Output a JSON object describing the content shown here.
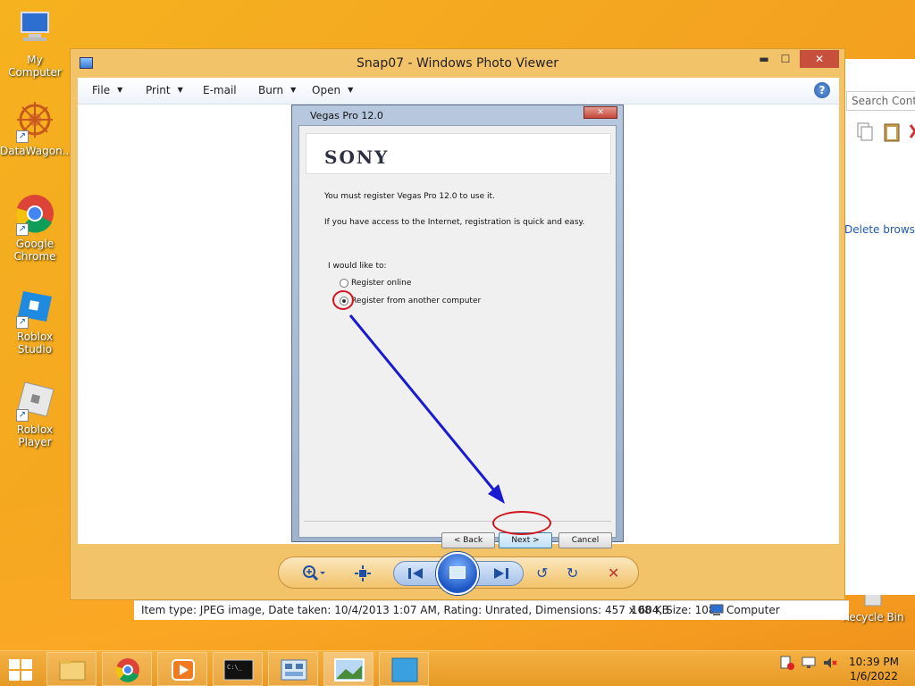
{
  "desktop": {
    "icons": [
      {
        "label": "My Computer"
      },
      {
        "label": "DataWagon..."
      },
      {
        "label": "Google Chrome"
      },
      {
        "label": "Roblox Studio"
      },
      {
        "label": "Roblox Player"
      },
      {
        "label": "Recycle Bin"
      }
    ]
  },
  "background_window": {
    "search_placeholder": "Search Contro",
    "link": "Delete browsing"
  },
  "window": {
    "title": "Snap07 - Windows Photo Viewer",
    "minimize": "▬",
    "maximize": "☐",
    "close": "✕",
    "menu": [
      {
        "label": "File"
      },
      {
        "label": "Print"
      },
      {
        "label": "E-mail"
      },
      {
        "label": "Burn"
      },
      {
        "label": "Open"
      }
    ],
    "help": "?"
  },
  "dialog": {
    "title": "Vegas Pro 12.0",
    "close": "✕",
    "brand": "SONY",
    "line1": "You must register Vegas Pro 12.0 to use it.",
    "line2": "If you have access to the Internet, registration is quick and easy.",
    "prompt": "I would like to:",
    "options": [
      {
        "label": "Register online",
        "selected": false
      },
      {
        "label": "Register from another computer",
        "selected": true
      }
    ],
    "back_label": "< Back",
    "next_label": "Next >",
    "cancel_label": "Cancel"
  },
  "status": {
    "info": "Item type: JPEG image, Date taken: 10/4/2013 1:07 AM, Rating: Unrated, Dimensions: 457 x 604, Size: 108",
    "size": "108 KB",
    "location": "Computer"
  },
  "taskbar": {
    "time": "10:39 PM",
    "date": "1/6/2022"
  },
  "colors": {
    "desktop": "#f4a620",
    "accent_blue": "#1c55c4",
    "annotation_red": "#d0141c",
    "annotation_arrow": "#1a1ad0"
  }
}
